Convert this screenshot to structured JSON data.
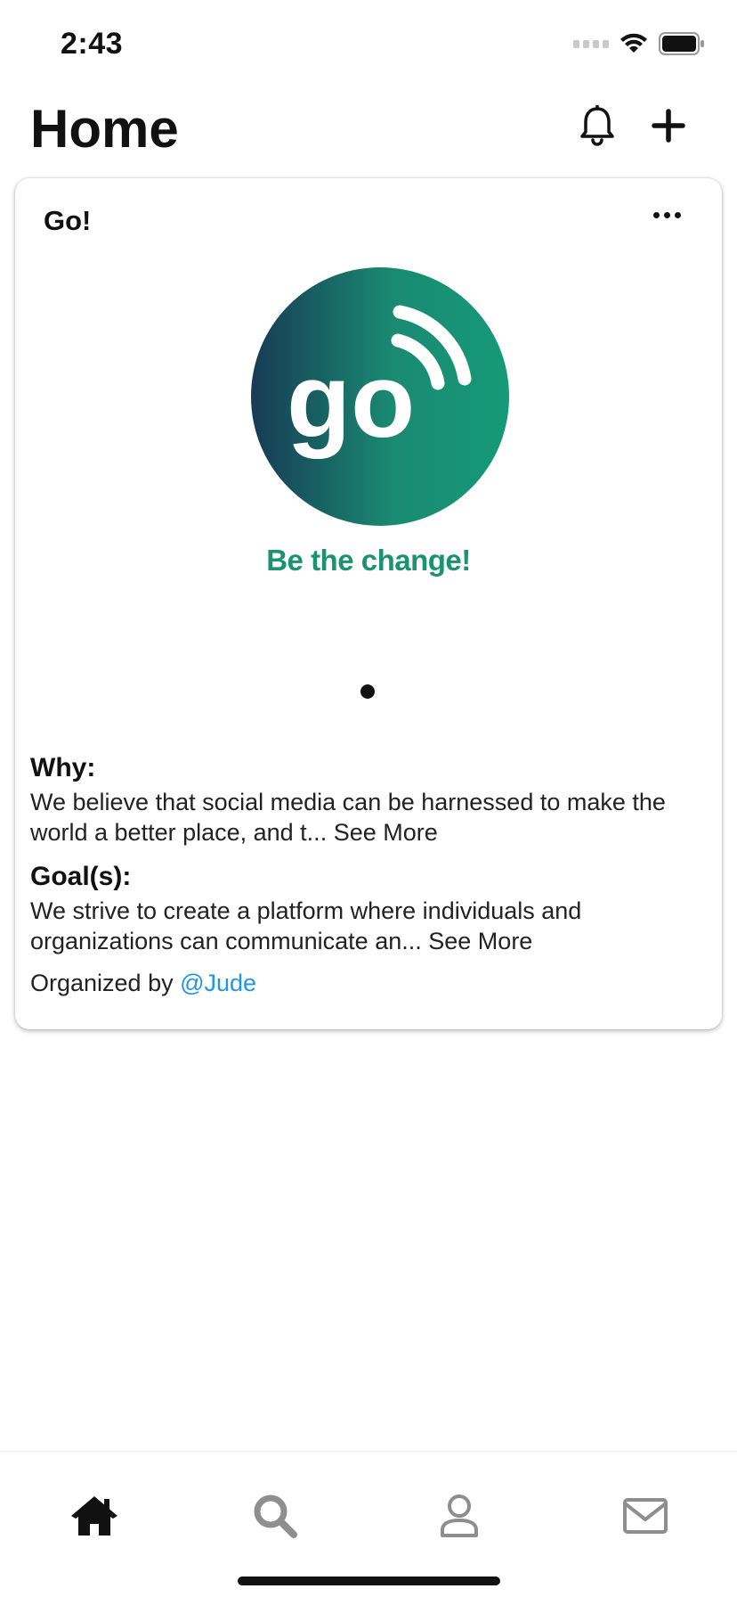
{
  "status_bar": {
    "time": "2:43"
  },
  "header": {
    "title": "Home",
    "actions": [
      {
        "icon": "bell-icon"
      },
      {
        "icon": "plus-icon"
      }
    ]
  },
  "card": {
    "title": "Go!",
    "logo_text": "go",
    "tagline": "Be the change!",
    "carousel_page": 1,
    "carousel_total": 1,
    "why": {
      "label": "Why:",
      "text": "We believe that social media can be harnessed to make the world a better place, and t...",
      "see_more": "See More"
    },
    "goals": {
      "label": "Goal(s):",
      "text": "We strive to create a platform where individuals and organizations can communicate an...",
      "see_more": "See More"
    },
    "organized_by_prefix": "Organized by",
    "organizer": "@Jude"
  },
  "tab_bar": {
    "items": [
      {
        "icon": "home-icon",
        "active": true
      },
      {
        "icon": "search-icon",
        "active": false
      },
      {
        "icon": "profile-icon",
        "active": false
      },
      {
        "icon": "mail-icon",
        "active": false
      }
    ]
  },
  "colors": {
    "accent_link": "#2196e8",
    "brand_green": "#1b9272",
    "brand_dark": "#1a3d57",
    "inactive_icon": "#8e8e8e"
  }
}
